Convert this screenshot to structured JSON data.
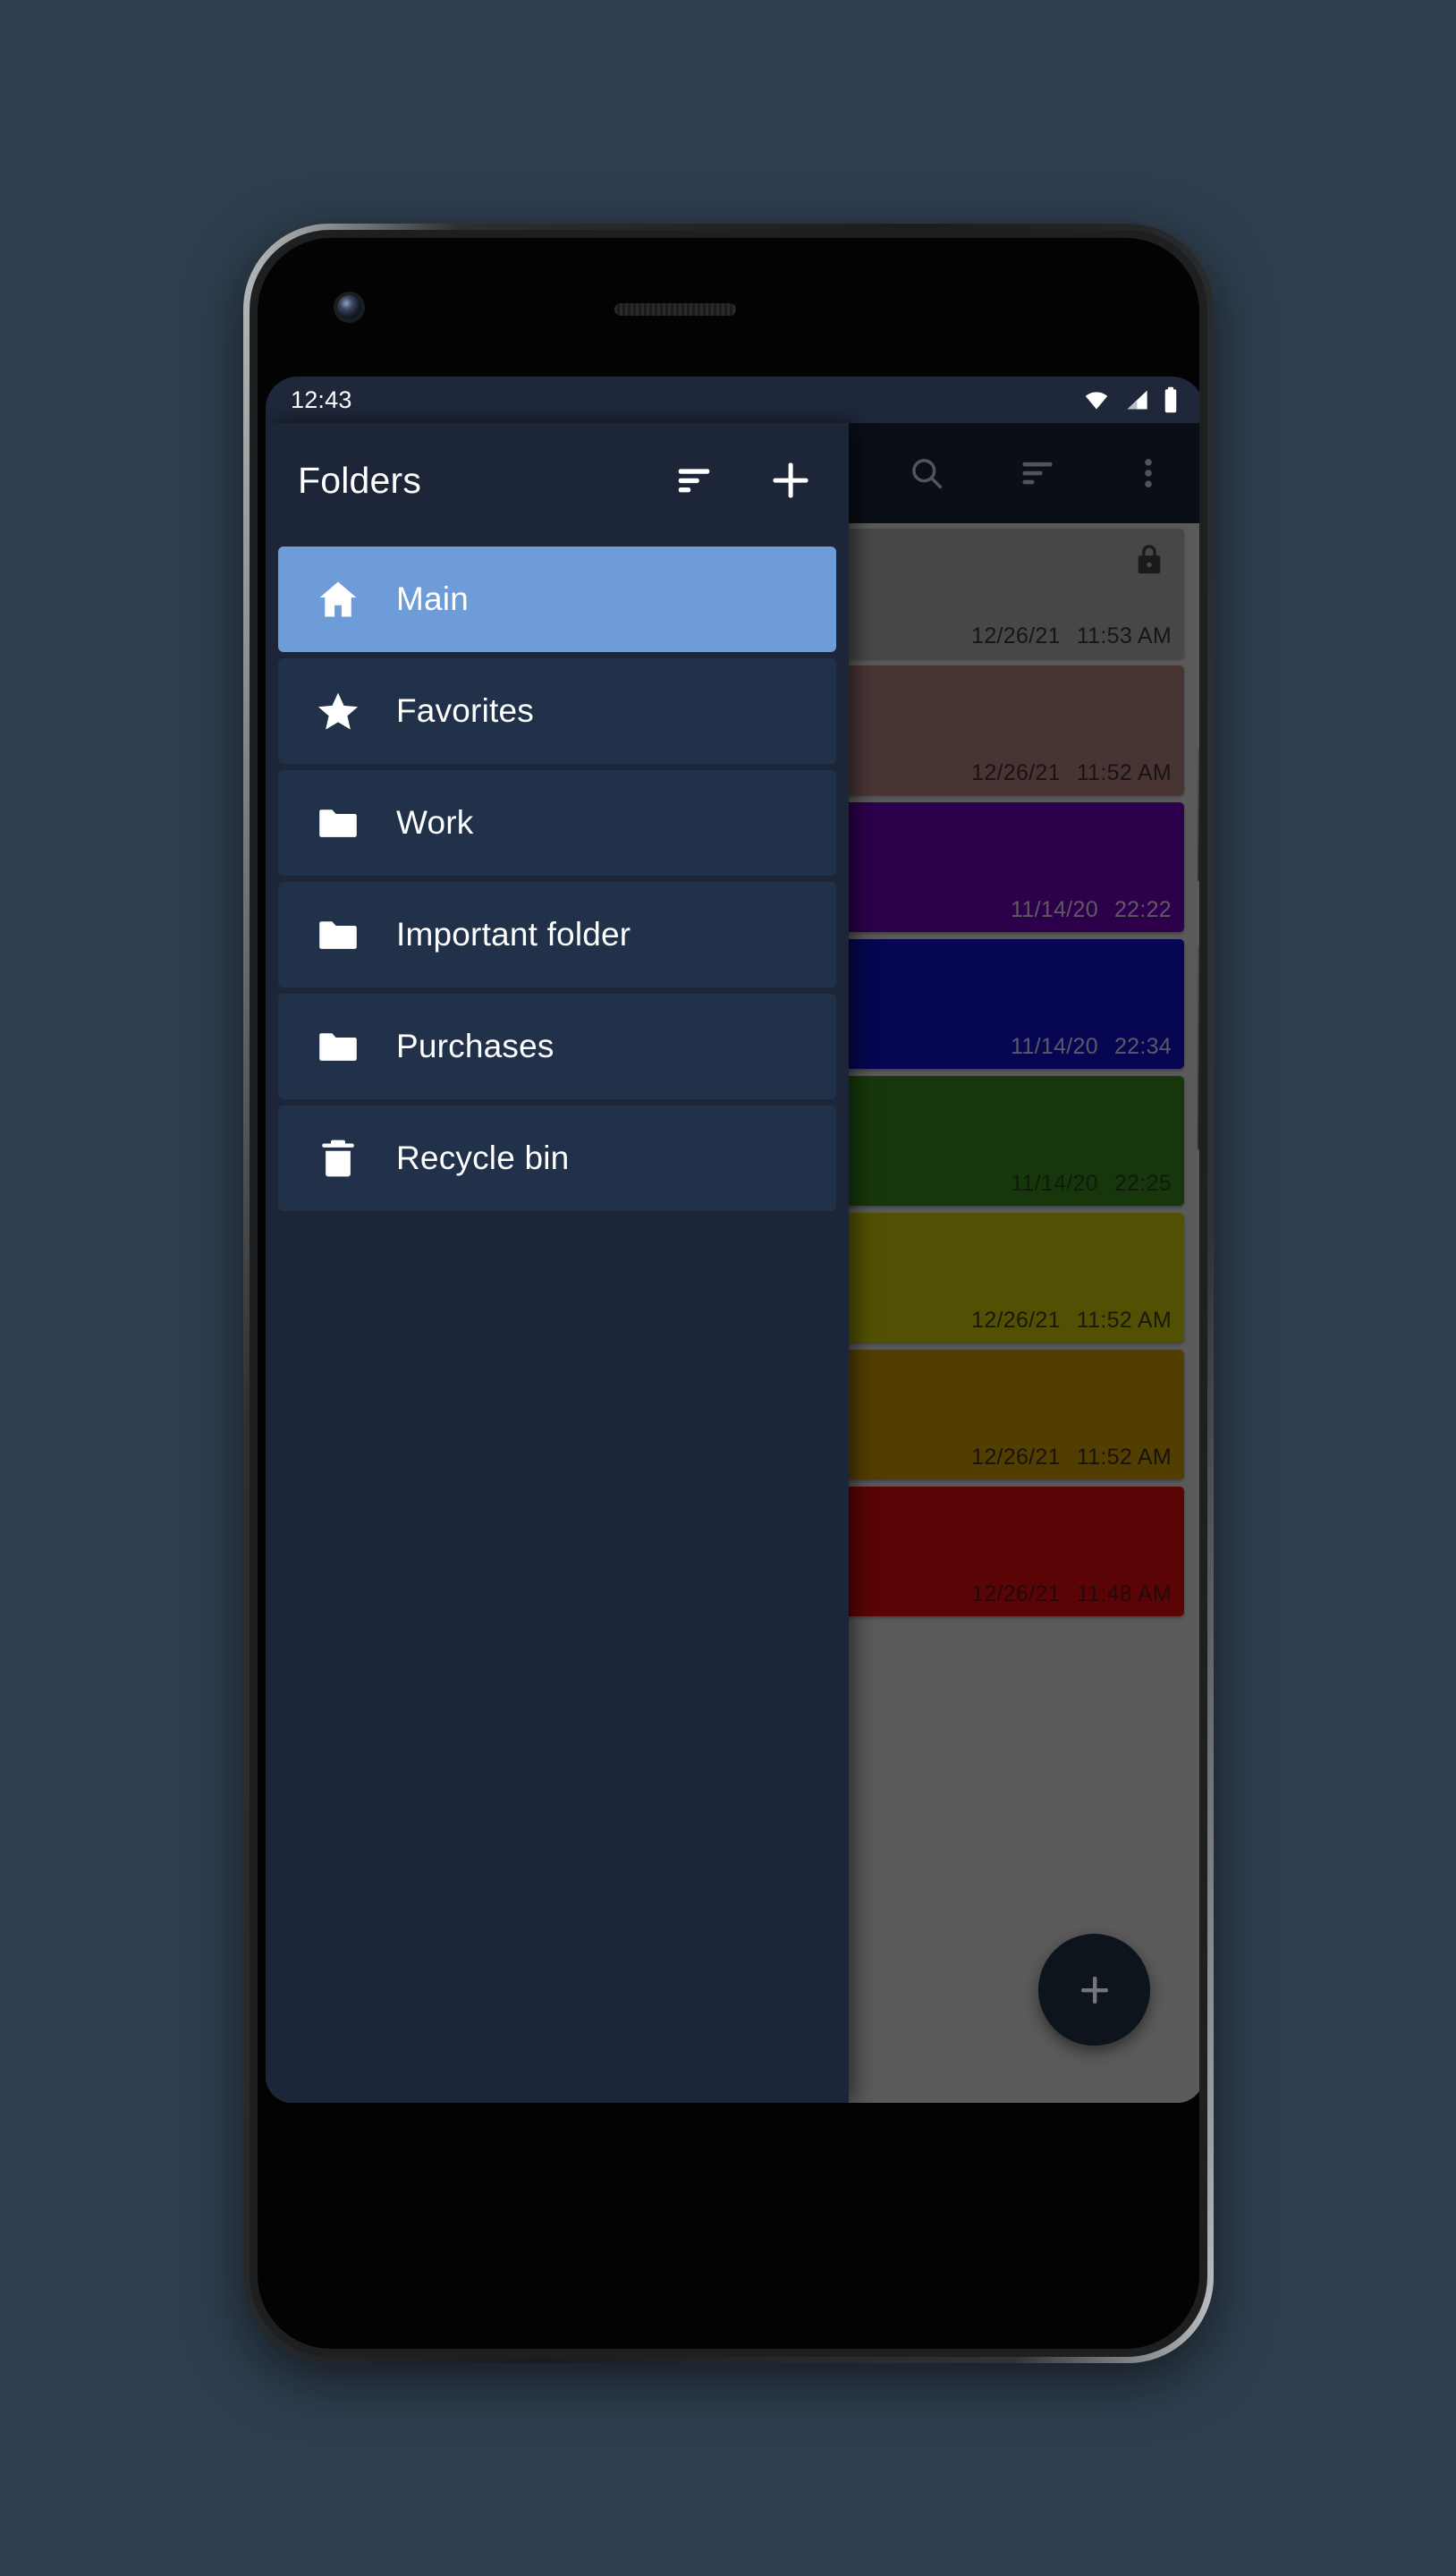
{
  "status_bar": {
    "time": "12:43",
    "icons": [
      "wifi-icon",
      "cellular-signal-icon",
      "battery-icon"
    ]
  },
  "drawer": {
    "title": "Folders",
    "actions": [
      {
        "name": "sort-icon",
        "label": "Sort folders"
      },
      {
        "name": "plus-icon",
        "label": "Add folder"
      }
    ],
    "items": [
      {
        "label": "Main",
        "icon": "home-icon",
        "selected": true
      },
      {
        "label": "Favorites",
        "icon": "star-icon",
        "selected": false
      },
      {
        "label": "Work",
        "icon": "folder-icon",
        "selected": false
      },
      {
        "label": "Important folder",
        "icon": "folder-icon",
        "selected": false
      },
      {
        "label": "Purchases",
        "icon": "folder-icon",
        "selected": false
      },
      {
        "label": "Recycle bin",
        "icon": "trash-icon",
        "selected": false
      }
    ]
  },
  "content": {
    "appbar_actions": [
      {
        "name": "search-icon",
        "label": "Search"
      },
      {
        "name": "sort-icon",
        "label": "Sort notes"
      },
      {
        "name": "overflow-menu-icon",
        "label": "More options"
      }
    ],
    "fab": {
      "name": "add-note-fab",
      "label": "+"
    },
    "notes": [
      {
        "date": "12/26/21",
        "time": "11:53 AM",
        "color": "#7a7a78",
        "text_color": "#26262a",
        "locked": true
      },
      {
        "date": "12/26/21",
        "time": "11:52 AM",
        "color": "#7e5a5b",
        "text_color": "#2b2224",
        "locked": false
      },
      {
        "date": "11/14/20",
        "time": "22:22",
        "color": "#4c0082",
        "text_color": "#a49aa9",
        "locked": false
      },
      {
        "date": "11/14/20",
        "time": "22:34",
        "color": "#0b0b8e",
        "text_color": "#9a9ab2",
        "locked": false
      },
      {
        "date": "11/14/20",
        "time": "22:25",
        "color": "#266016",
        "text_color": "#1c2e17",
        "locked": false
      },
      {
        "date": "12/26/21",
        "time": "11:52 AM",
        "color": "#8d8c06",
        "text_color": "#2c2b11",
        "locked": false
      },
      {
        "date": "12/26/21",
        "time": "11:52 AM",
        "color": "#8f6c04",
        "text_color": "#2b2310",
        "locked": false
      },
      {
        "date": "12/26/21",
        "time": "11:48 AM",
        "color": "#9d0709",
        "text_color": "#3b1214",
        "locked": false
      }
    ]
  },
  "theme": {
    "page_background": "#2e3e4e",
    "drawer_background": "#1c2638",
    "drawer_item_background": "#22314a",
    "drawer_item_selected": "#6d9cd8",
    "appbar_background": "#121a26",
    "status_bar_background": "#1e283a",
    "content_background": "#9b9b9b",
    "fab_background": "#172431"
  }
}
